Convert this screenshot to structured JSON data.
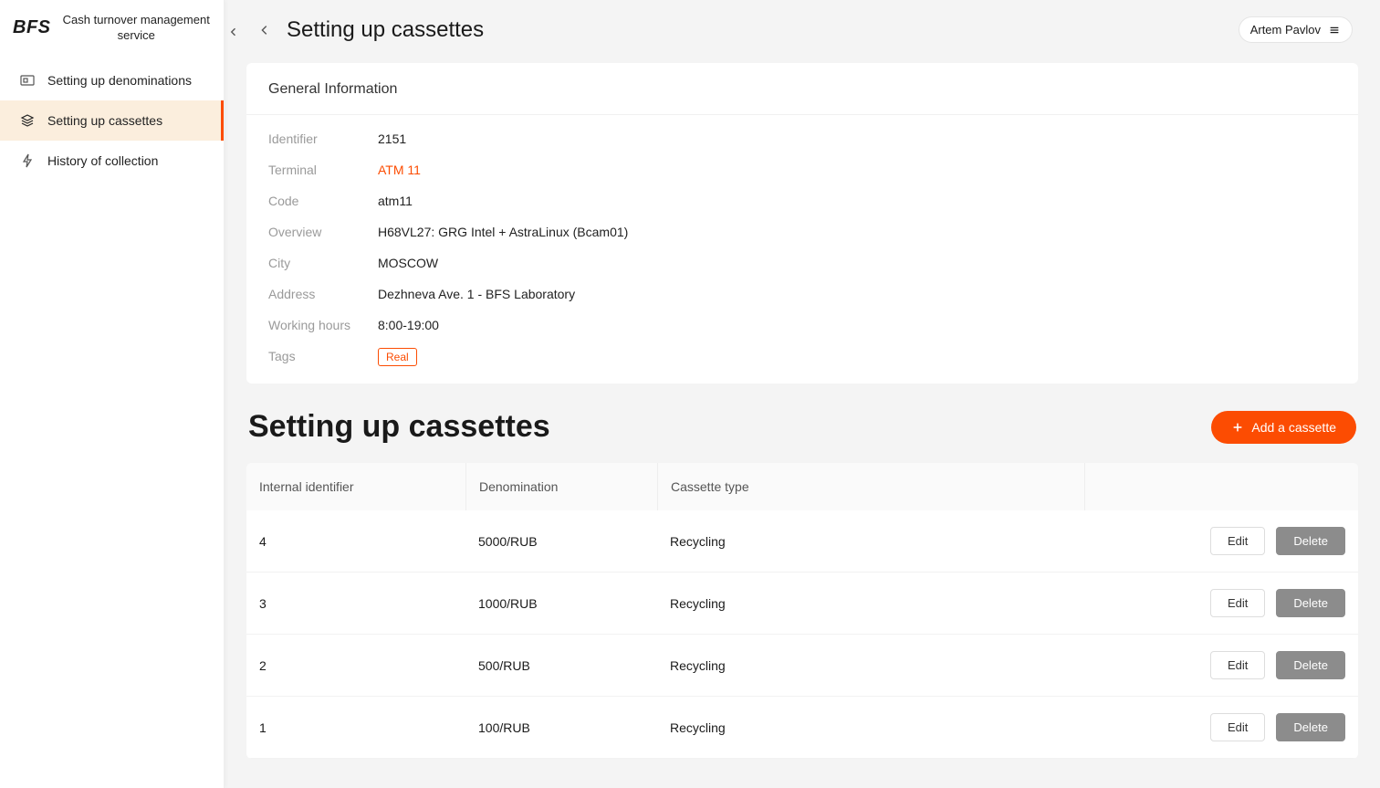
{
  "brand": "BFS",
  "service_name": "Cash turnover management service",
  "nav": {
    "items": [
      {
        "label": "Setting up denominations"
      },
      {
        "label": "Setting up cassettes"
      },
      {
        "label": "History of collection"
      }
    ]
  },
  "header": {
    "title": "Setting up cassettes",
    "user": "Artem Pavlov"
  },
  "info": {
    "card_title": "General Information",
    "rows": {
      "identifier": {
        "label": "Identifier",
        "value": "2151"
      },
      "terminal": {
        "label": "Terminal",
        "value": "ATM 11"
      },
      "code": {
        "label": "Code",
        "value": "atm11"
      },
      "overview": {
        "label": "Overview",
        "value": "H68VL27: GRG Intel + AstraLinux (Bcam01)"
      },
      "city": {
        "label": "City",
        "value": "MOSCOW"
      },
      "address": {
        "label": "Address",
        "value": "Dezhneva Ave. 1 - BFS Laboratory"
      },
      "hours": {
        "label": "Working hours",
        "value": "8:00-19:00"
      },
      "tags": {
        "label": "Tags",
        "value": "Real"
      }
    }
  },
  "section": {
    "title": "Setting up cassettes",
    "add_label": "Add a cassette"
  },
  "table": {
    "columns": [
      "Internal identifier",
      "Denomination",
      "Cassette type"
    ],
    "edit_label": "Edit",
    "delete_label": "Delete",
    "rows": [
      {
        "id": "4",
        "denom": "5000/RUB",
        "type": "Recycling"
      },
      {
        "id": "3",
        "denom": "1000/RUB",
        "type": "Recycling"
      },
      {
        "id": "2",
        "denom": "500/RUB",
        "type": "Recycling"
      },
      {
        "id": "1",
        "denom": "100/RUB",
        "type": "Recycling"
      }
    ]
  }
}
